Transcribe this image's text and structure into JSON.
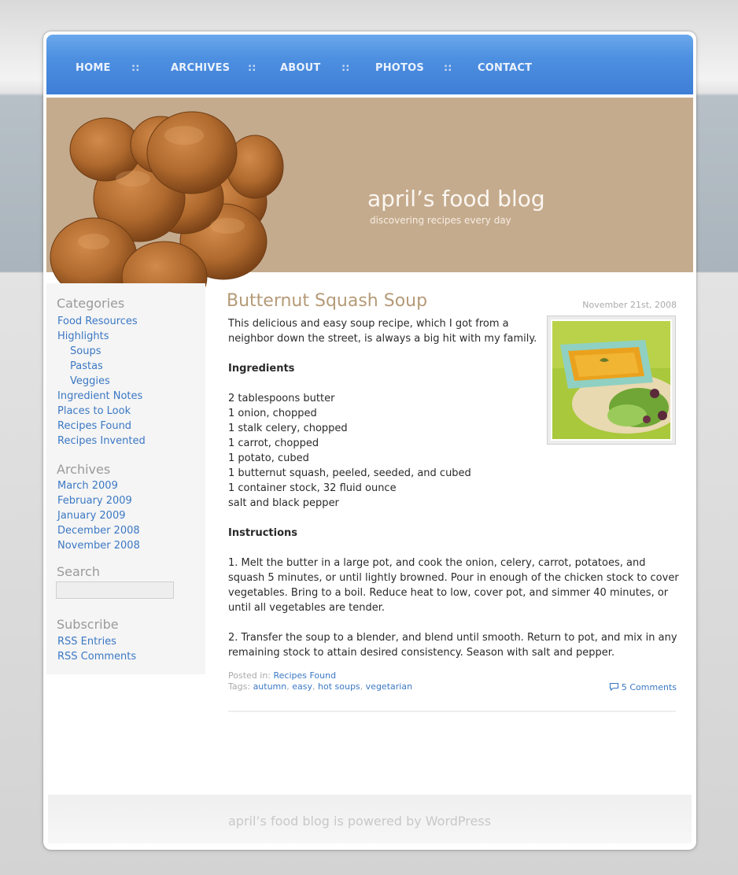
{
  "nav": {
    "items": [
      "HOME",
      "ARCHIVES",
      "ABOUT",
      "PHOTOS",
      "CONTACT"
    ],
    "separator": "::"
  },
  "header": {
    "title": "april’s food blog",
    "tagline": "discovering recipes every day"
  },
  "sidebar": {
    "categories_heading": "Categories",
    "categories": [
      "Food Resources",
      "Highlights",
      "Soups",
      "Pastas",
      "Veggies",
      "Ingredient Notes",
      "Places to Look",
      "Recipes Found",
      "Recipes Invented"
    ],
    "archives_heading": "Archives",
    "archives": [
      "March 2009",
      "February 2009",
      "January 2009",
      "December 2008",
      "November 2008"
    ],
    "search_heading": "Search",
    "subscribe_heading": "Subscribe",
    "subscribe": [
      "RSS Entries",
      "RSS Comments"
    ]
  },
  "post": {
    "title": "Butternut Squash Soup",
    "date": "November 21st, 2008",
    "intro_1": "This delicious and easy soup recipe, which I got from a",
    "intro_2": "neighbor down the street, is always a big hit with my family.",
    "ingredients_heading": "Ingredients",
    "ingredients": [
      "2 tablespoons butter",
      "1 onion, chopped",
      "1 stalk celery, chopped",
      "1 carrot, chopped",
      "1 potato, cubed",
      "1 butternut squash, peeled, seeded, and cubed",
      "1 container stock, 32 fluid ounce",
      "salt and black pepper"
    ],
    "instructions_heading": "Instructions",
    "instructions_1": [
      "1. Melt the butter in a large pot, and cook the onion, celery, carrot, potatoes, and",
      "squash 5 minutes, or until lightly browned. Pour in enough of the chicken stock to cover",
      "vegetables. Bring to a boil. Reduce heat to low, cover pot, and simmer 40 minutes, or",
      "until all vegetables are tender."
    ],
    "instructions_2": [
      "2. Transfer the soup to a blender, and blend until smooth. Return to pot, and mix in any",
      "remaining stock to attain desired consistency. Season with salt and pepper."
    ],
    "posted_in_label": "Posted in:",
    "posted_in": "Recipes Found",
    "tags_label": "Tags:",
    "tags": [
      "autumn",
      "easy",
      "hot soups",
      "vegetarian"
    ],
    "comments": "5 Comments"
  },
  "footer": {
    "text": "april’s food blog is powered by WordPress"
  },
  "colors": {
    "nav_blue": "#4d8fe0",
    "header_tan": "#c5ab8d",
    "link_blue": "#3b78c4",
    "title_tan": "#b59a77"
  },
  "icons": [
    "comment-bubble-icon"
  ]
}
